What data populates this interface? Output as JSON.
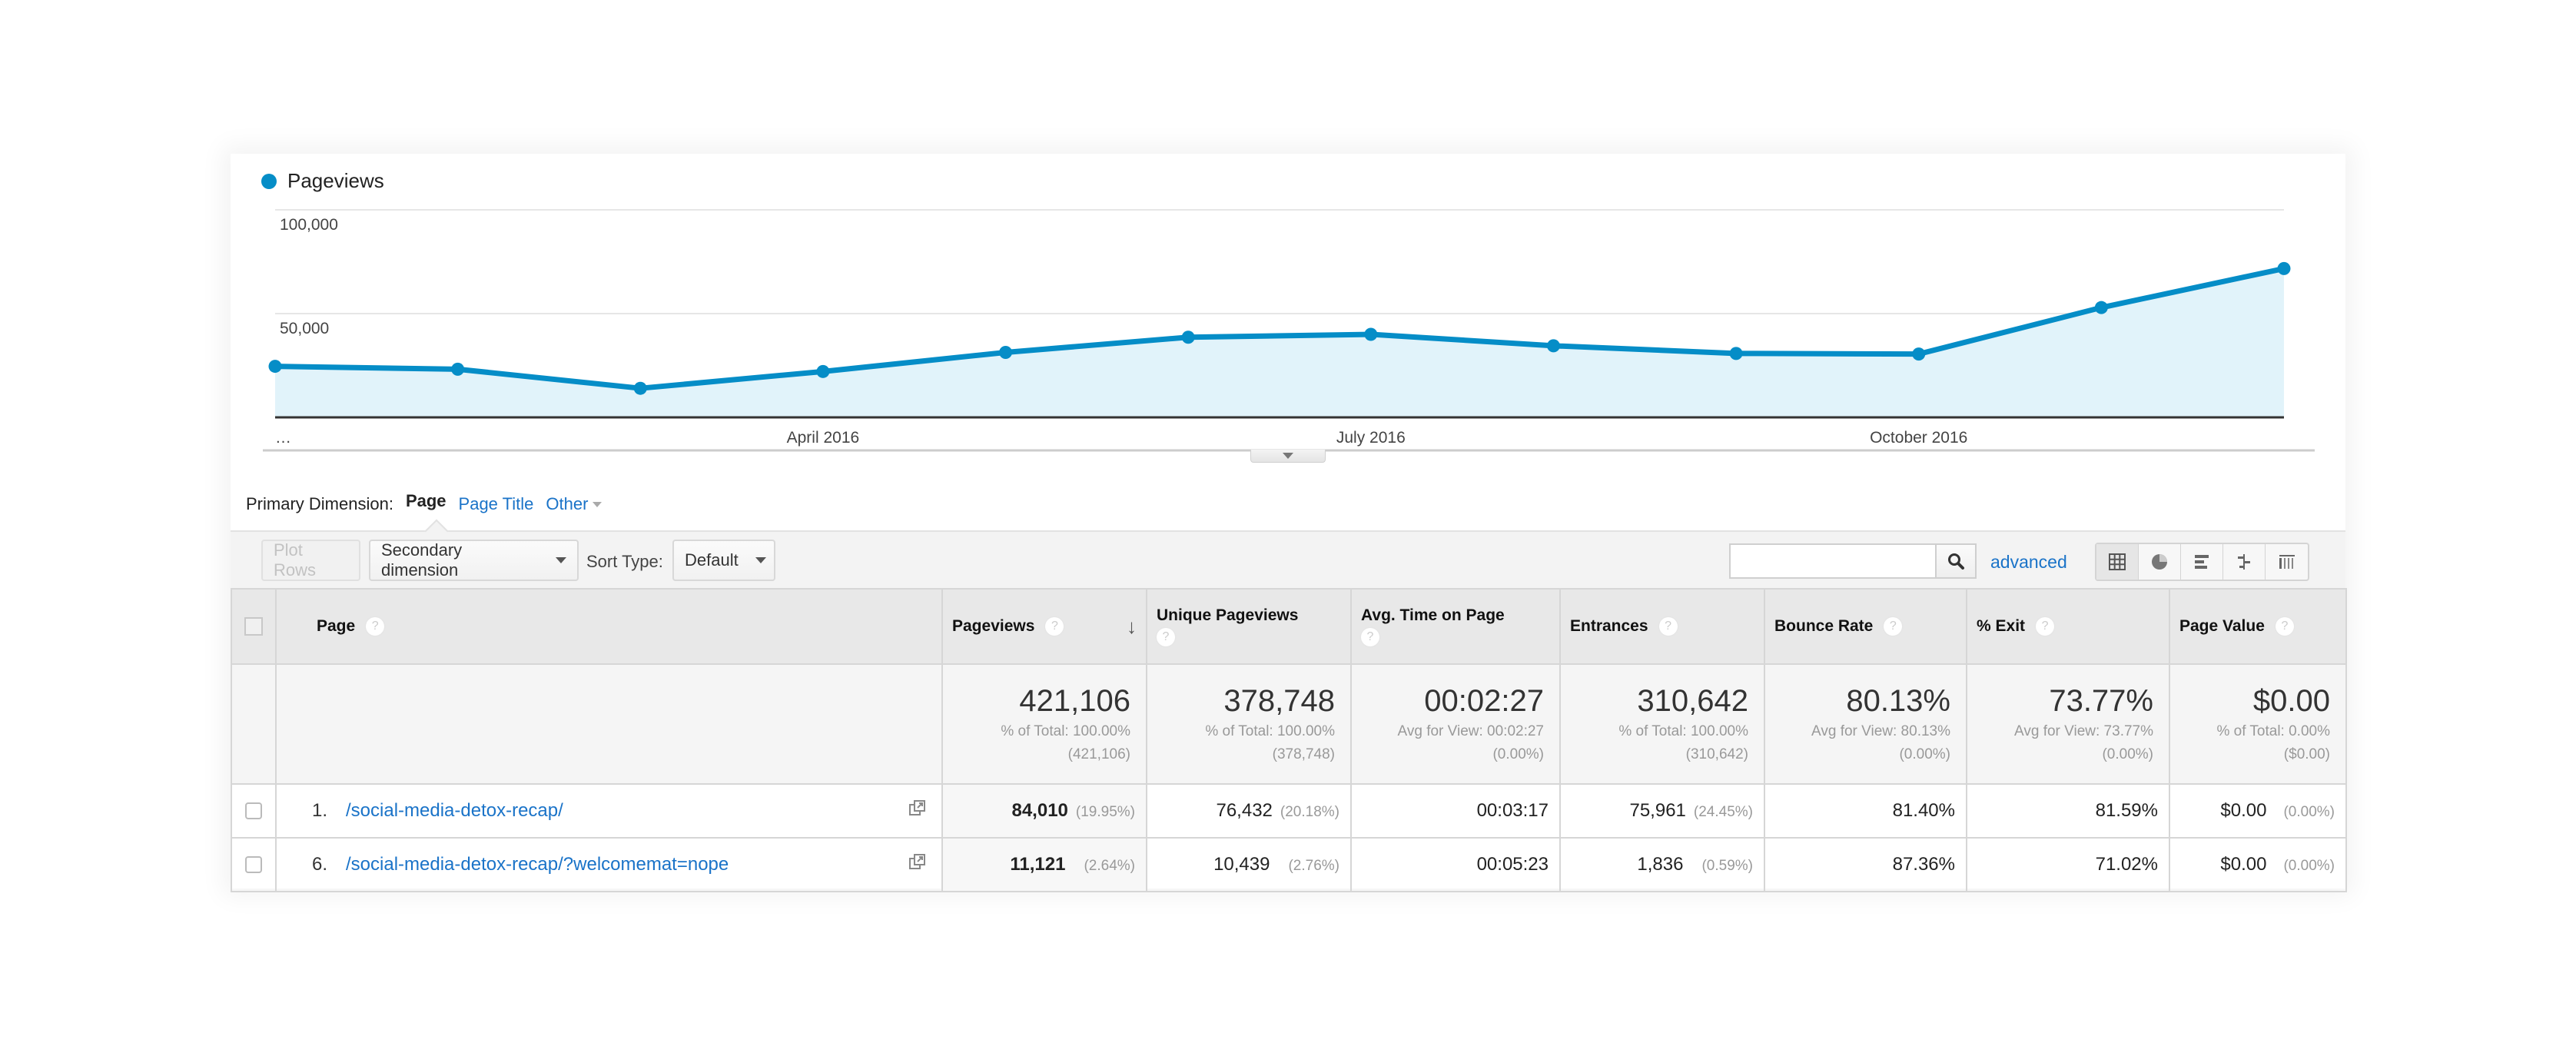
{
  "chart_data": {
    "type": "line",
    "title": "",
    "legend": [
      "Pageviews"
    ],
    "legend_position": "top-left",
    "series": [
      {
        "name": "Pageviews",
        "color": "#058dc7",
        "values": [
          24600,
          23200,
          14000,
          22100,
          31300,
          38600,
          40000,
          34500,
          30800,
          30500,
          52900,
          71700
        ]
      }
    ],
    "x": [
      "…",
      "",
      "",
      "April 2016",
      "",
      "",
      "July 2016",
      "",
      "",
      "October 2016",
      "",
      ""
    ],
    "x_tick_labels": [
      {
        "label": "…",
        "index": 0
      },
      {
        "label": "April 2016",
        "index": 3
      },
      {
        "label": "July 2016",
        "index": 6
      },
      {
        "label": "October 2016",
        "index": 9
      }
    ],
    "y_ticks": [
      {
        "value": 50000,
        "label": "50,000"
      },
      {
        "value": 100000,
        "label": "100,000"
      }
    ],
    "ylim": [
      0,
      100000
    ],
    "grid": true,
    "area_fill": "#e1f3fa",
    "xlabel": "",
    "ylabel": ""
  },
  "primary_dimension": {
    "label": "Primary Dimension:",
    "active": "Page",
    "options": [
      "Page Title",
      "Other"
    ]
  },
  "toolbar": {
    "plot_rows": "Plot Rows",
    "secondary_dimension": "Secondary dimension",
    "sort_type_label": "Sort Type:",
    "sort_type_value": "Default",
    "search_value": "",
    "search_placeholder": "",
    "advanced": "advanced",
    "view_icons": [
      "table-view-icon",
      "pie-view-icon",
      "performance-view-icon",
      "comparison-view-icon",
      "pivot-view-icon"
    ]
  },
  "table": {
    "columns": [
      {
        "label": "Page",
        "help": "?"
      },
      {
        "label": "Pageviews",
        "help": "?",
        "sorted": "desc"
      },
      {
        "label": "Unique Pageviews",
        "help": "?"
      },
      {
        "label": "Avg. Time on Page",
        "help": "?"
      },
      {
        "label": "Entrances",
        "help": "?"
      },
      {
        "label": "Bounce Rate",
        "help": "?"
      },
      {
        "label": "% Exit",
        "help": "?"
      },
      {
        "label": "Page Value",
        "help": "?"
      }
    ],
    "totals": [
      {
        "main": "421,106",
        "sub1": "% of Total: 100.00%",
        "sub2": "(421,106)"
      },
      {
        "main": "378,748",
        "sub1": "% of Total: 100.00%",
        "sub2": "(378,748)"
      },
      {
        "main": "00:02:27",
        "sub1": "Avg for View: 00:02:27",
        "sub2": "(0.00%)"
      },
      {
        "main": "310,642",
        "sub1": "% of Total: 100.00%",
        "sub2": "(310,642)"
      },
      {
        "main": "80.13%",
        "sub1": "Avg for View: 80.13%",
        "sub2": "(0.00%)"
      },
      {
        "main": "73.77%",
        "sub1": "Avg for View: 73.77%",
        "sub2": "(0.00%)"
      },
      {
        "main": "$0.00",
        "sub1": "% of Total: 0.00%",
        "sub2": "($0.00)"
      }
    ],
    "rows": [
      {
        "index": "1.",
        "page": "/social-media-detox-recap/",
        "pageviews": "84,010",
        "pageviews_pct": "(19.95%)",
        "unique": "76,432",
        "unique_pct": "(20.18%)",
        "avg_time": "00:03:17",
        "entrances": "75,961",
        "entrances_pct": "(24.45%)",
        "bounce": "81.40%",
        "exit": "81.59%",
        "value": "$0.00",
        "value_pct": "(0.00%)"
      },
      {
        "index": "6.",
        "page": "/social-media-detox-recap/?welcomemat=nope",
        "pageviews": "11,121",
        "pageviews_pct": "(2.64%)",
        "unique": "10,439",
        "unique_pct": "(2.76%)",
        "avg_time": "00:05:23",
        "entrances": "1,836",
        "entrances_pct": "(0.59%)",
        "bounce": "87.36%",
        "exit": "71.02%",
        "value": "$0.00",
        "value_pct": "(0.00%)"
      }
    ]
  }
}
